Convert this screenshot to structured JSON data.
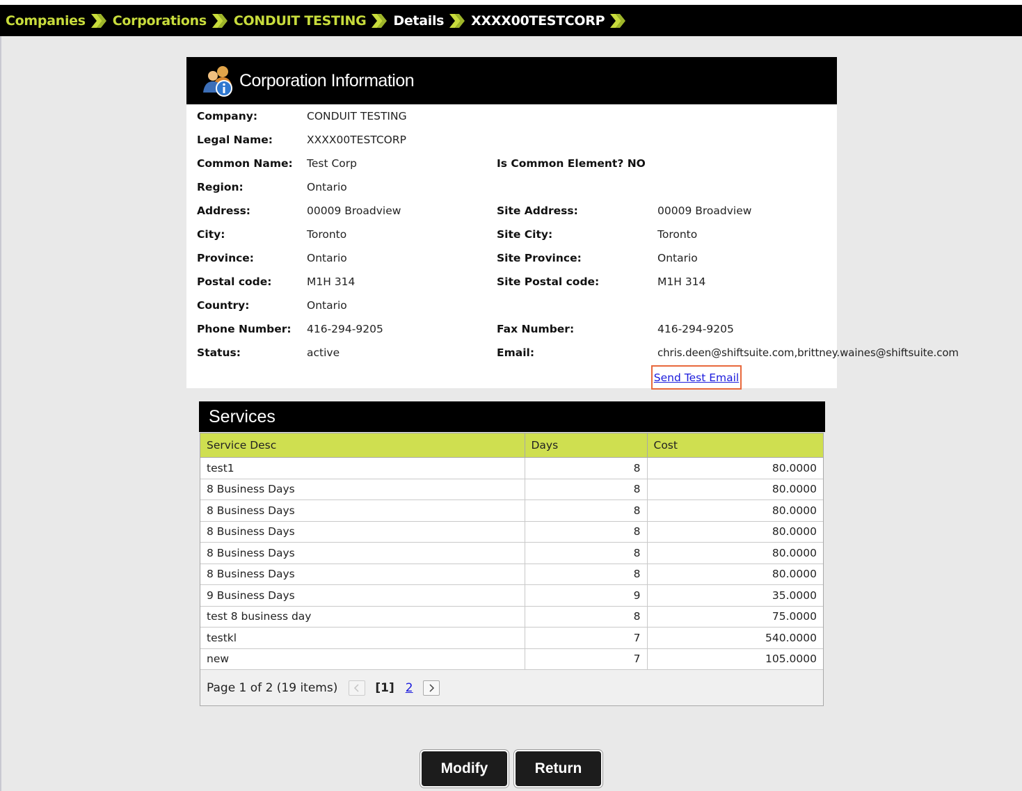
{
  "breadcrumb": {
    "items": [
      "Companies",
      "Corporations",
      "CONDUIT TESTING",
      "Details",
      "XXXX00TESTCORP"
    ]
  },
  "corp_panel": {
    "title": "Corporation Information",
    "icon": "corporation-info-icon",
    "left_fields": [
      {
        "label": "Company:",
        "value": "CONDUIT TESTING"
      },
      {
        "label": "Legal Name:",
        "value": "XXXX00TESTCORP"
      },
      {
        "label": "Common Name:",
        "value": "Test Corp"
      },
      {
        "label": "Region:",
        "value": "Ontario"
      },
      {
        "label": "Address:",
        "value": "00009 Broadview"
      },
      {
        "label": "City:",
        "value": "Toronto"
      },
      {
        "label": "Province:",
        "value": "Ontario"
      },
      {
        "label": "Postal code:",
        "value": "M1H 314"
      },
      {
        "label": "Country:",
        "value": "Ontario"
      },
      {
        "label": "Phone Number:",
        "value": "416-294-9205"
      },
      {
        "label": "Status:",
        "value": "active"
      }
    ],
    "common_element": "Is Common Element? NO",
    "right_fields": [
      {
        "label": "Site Address:",
        "value": "00009 Broadview"
      },
      {
        "label": "Site City:",
        "value": "Toronto"
      },
      {
        "label": "Site Province:",
        "value": "Ontario"
      },
      {
        "label": "Site Postal code:",
        "value": "M1H 314"
      },
      {
        "label": "Fax Number:",
        "value": "416-294-9205"
      },
      {
        "label": "Email:",
        "value": "chris.deen@shiftsuite.com,brittney.waines@shiftsuite.com"
      }
    ],
    "send_test_email": "Send Test Email"
  },
  "services": {
    "title": "Services",
    "columns": [
      "Service Desc",
      "Days",
      "Cost"
    ],
    "rows": [
      [
        "test1",
        "8",
        "80.0000"
      ],
      [
        "8 Business Days",
        "8",
        "80.0000"
      ],
      [
        "8 Business Days",
        "8",
        "80.0000"
      ],
      [
        "8 Business Days",
        "8",
        "80.0000"
      ],
      [
        "8 Business Days",
        "8",
        "80.0000"
      ],
      [
        "8 Business Days",
        "8",
        "80.0000"
      ],
      [
        "9 Business Days",
        "9",
        "35.0000"
      ],
      [
        "test 8 business day",
        "8",
        "75.0000"
      ],
      [
        "testkl",
        "7",
        "540.0000"
      ],
      [
        "new",
        "7",
        "105.0000"
      ]
    ],
    "pager": {
      "summary": "Page 1 of 2 (19 items)",
      "current": "[1]",
      "next_page": "2"
    }
  },
  "buttons": {
    "modify": "Modify",
    "return": "Return"
  },
  "colors": {
    "accent_green": "#cfdf50",
    "breadcrumb_link": "#c8dc3c",
    "header_black": "#000000",
    "highlight_border": "#e8683b",
    "link_blue": "#1a1adc"
  }
}
